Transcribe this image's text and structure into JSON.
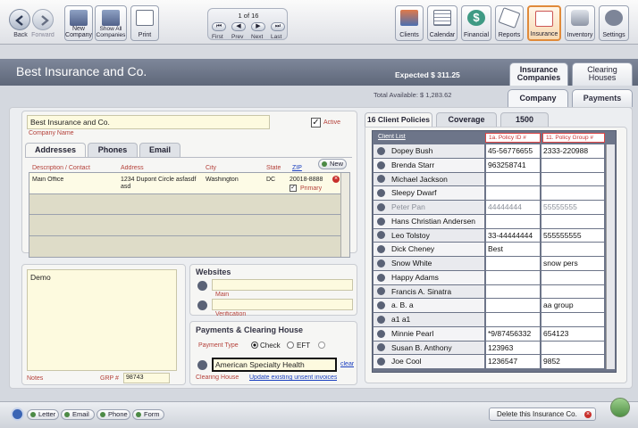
{
  "toolbar": {
    "back": "Back",
    "forward": "Forward",
    "new_company": "New Company",
    "show_all": "Show All Companies",
    "print": "Print",
    "pager_status": "1 of 16",
    "first": "First",
    "prev": "Prev",
    "next": "Next",
    "last": "Last",
    "clients": "Clients",
    "calendar": "Calendar",
    "financial": "Financial",
    "reports": "Reports",
    "insurance": "Insurance",
    "inventory": "Inventory",
    "settings": "Settings"
  },
  "header": {
    "title": "Best Insurance and Co.",
    "expected": "Expected $ 311.25",
    "total_available": "Total Available: $ 1,283.62",
    "tab_insurance": "Insurance Companies",
    "tab_clearing": "Clearing Houses",
    "subtab_company": "Company",
    "subtab_payments": "Payments"
  },
  "company": {
    "name": "Best Insurance and Co.",
    "name_label": "Company Name",
    "active_label": "Active",
    "active": true
  },
  "contact_tabs": [
    "Addresses",
    "Phones",
    "Email"
  ],
  "addresses": {
    "headers": [
      "Description / Contact",
      "Address",
      "City",
      "State",
      "ZIP"
    ],
    "new_label": "New",
    "row": {
      "desc": "Main Office",
      "address": "1234 Dupont Circle asfasdf asd",
      "city": "Washington",
      "state": "DC",
      "zip": "20018-8888",
      "primary_label": "Primary"
    }
  },
  "notes": {
    "value": "Demo",
    "label": "Notes",
    "grp_label": "GRP #",
    "grp_value": "98743"
  },
  "websites": {
    "title": "Websites",
    "main_label": "Main",
    "verification_label": "Verification"
  },
  "payments": {
    "title": "Payments & Clearing House",
    "type_label": "Payment Type",
    "check": "Check",
    "eft": "EFT",
    "clearing_value": "American Specialty Health",
    "clear": "clear",
    "clearing_label": "Clearing House",
    "update_link": "Update existing unsent invoices"
  },
  "policies": {
    "tabs": [
      "16 Client Policies",
      "Coverage",
      "1500"
    ],
    "client_list": "Client List",
    "col_policy": "1a. Policy ID #",
    "col_group": "11. Policy Group #",
    "rows": [
      {
        "name": "Dopey Bush",
        "policy": "45-56776655",
        "group": "2333-220988",
        "dim": false
      },
      {
        "name": "Brenda Starr",
        "policy": "963258741",
        "group": "",
        "dim": false
      },
      {
        "name": "Michael Jackson",
        "policy": "",
        "group": "",
        "dim": false
      },
      {
        "name": "Sleepy Dwarf",
        "policy": "",
        "group": "",
        "dim": false
      },
      {
        "name": "Peter Pan",
        "policy": "44444444",
        "group": "55555555",
        "dim": true
      },
      {
        "name": "Hans Christian Andersen",
        "policy": "",
        "group": "",
        "dim": false
      },
      {
        "name": "Leo Tolstoy",
        "policy": "33-44444444",
        "group": "555555555",
        "dim": false
      },
      {
        "name": "Dick Cheney",
        "policy": "Best",
        "group": "",
        "dim": false
      },
      {
        "name": "Snow White",
        "policy": "",
        "group": "snow pers",
        "dim": false
      },
      {
        "name": "Happy Adams",
        "policy": "",
        "group": "",
        "dim": false
      },
      {
        "name": "Francis A. Sinatra",
        "policy": "",
        "group": "",
        "dim": false
      },
      {
        "name": "a. B. a",
        "policy": "",
        "group": "aa group",
        "dim": false
      },
      {
        "name": "a1 a1",
        "policy": "",
        "group": "",
        "dim": false
      },
      {
        "name": "Minnie Pearl",
        "policy": "*9/87456332",
        "group": "654123",
        "dim": false
      },
      {
        "name": "Susan B. Anthony",
        "policy": "123963",
        "group": "",
        "dim": false
      },
      {
        "name": "Joe Cool",
        "policy": "1236547",
        "group": "9852",
        "dim": false
      }
    ]
  },
  "bottom": {
    "letter": "Letter",
    "email": "Email",
    "phone": "Phone",
    "form": "Form",
    "delete": "Delete this Insurance Co."
  }
}
